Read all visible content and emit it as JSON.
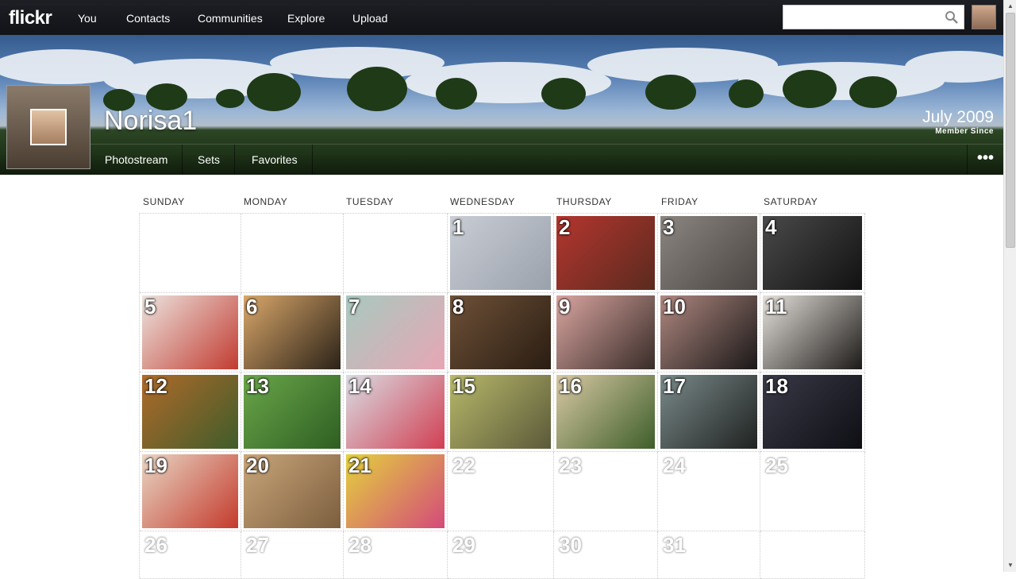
{
  "nav": {
    "logo": "flickr",
    "links": [
      "You",
      "Contacts",
      "Communities",
      "Explore",
      "Upload"
    ],
    "search_placeholder": ""
  },
  "profile": {
    "username": "Norisa1",
    "member_since_date": "July 2009",
    "member_since_label": "Member Since",
    "tabs": [
      "Photostream",
      "Sets",
      "Favorites"
    ],
    "more": "•••"
  },
  "calendar": {
    "weekdays": [
      "SUNDAY",
      "MONDAY",
      "TUESDAY",
      "WEDNESDAY",
      "THURSDAY",
      "FRIDAY",
      "SATURDAY"
    ],
    "days": [
      {
        "n": "1",
        "photo": true,
        "colors": [
          "#c9cdd4",
          "#9aa1ac"
        ]
      },
      {
        "n": "2",
        "photo": true,
        "colors": [
          "#b3362f",
          "#5b2a1e"
        ]
      },
      {
        "n": "3",
        "photo": true,
        "colors": [
          "#8c8682",
          "#4a4542"
        ]
      },
      {
        "n": "4",
        "photo": true,
        "colors": [
          "#4a4a4a",
          "#111111"
        ]
      },
      {
        "n": "5",
        "photo": true,
        "colors": [
          "#ece4de",
          "#c23b31"
        ]
      },
      {
        "n": "6",
        "photo": true,
        "colors": [
          "#d9a76a",
          "#2b2218"
        ]
      },
      {
        "n": "7",
        "photo": true,
        "colors": [
          "#a8c9c0",
          "#e7a6b4"
        ]
      },
      {
        "n": "8",
        "photo": true,
        "colors": [
          "#6e5138",
          "#2a1d12"
        ]
      },
      {
        "n": "9",
        "photo": true,
        "colors": [
          "#d9a5a0",
          "#382c28"
        ]
      },
      {
        "n": "10",
        "photo": true,
        "colors": [
          "#b08880",
          "#1a1818"
        ]
      },
      {
        "n": "11",
        "photo": true,
        "colors": [
          "#e6e2dc",
          "#1c1a18"
        ]
      },
      {
        "n": "12",
        "photo": true,
        "colors": [
          "#b06a2a",
          "#3f5c2a"
        ]
      },
      {
        "n": "13",
        "photo": true,
        "colors": [
          "#6aa64a",
          "#2e5e22"
        ]
      },
      {
        "n": "14",
        "photo": true,
        "colors": [
          "#d9dde4",
          "#d13f52"
        ]
      },
      {
        "n": "15",
        "photo": true,
        "colors": [
          "#b7b86a",
          "#5b5a3a"
        ]
      },
      {
        "n": "16",
        "photo": true,
        "colors": [
          "#d8c9a4",
          "#3e5e2a"
        ]
      },
      {
        "n": "17",
        "photo": true,
        "colors": [
          "#7a8a8a",
          "#1f2220"
        ]
      },
      {
        "n": "18",
        "photo": true,
        "colors": [
          "#3a3a48",
          "#0e0e14"
        ]
      },
      {
        "n": "19",
        "photo": true,
        "colors": [
          "#e8d6c4",
          "#c43a2c"
        ]
      },
      {
        "n": "20",
        "photo": true,
        "colors": [
          "#c9a67a",
          "#7c5e3e"
        ]
      },
      {
        "n": "21",
        "photo": true,
        "colors": [
          "#e3d23e",
          "#d44a7a"
        ]
      },
      {
        "n": "22",
        "photo": false
      },
      {
        "n": "23",
        "photo": false
      },
      {
        "n": "24",
        "photo": false
      },
      {
        "n": "25",
        "photo": false
      },
      {
        "n": "26",
        "photo": false
      },
      {
        "n": "27",
        "photo": false
      },
      {
        "n": "28",
        "photo": false
      },
      {
        "n": "29",
        "photo": false
      },
      {
        "n": "30",
        "photo": false
      },
      {
        "n": "31",
        "photo": false
      }
    ]
  },
  "colors": {
    "topbar": "#16181c",
    "grid_line": "#cccccc"
  }
}
